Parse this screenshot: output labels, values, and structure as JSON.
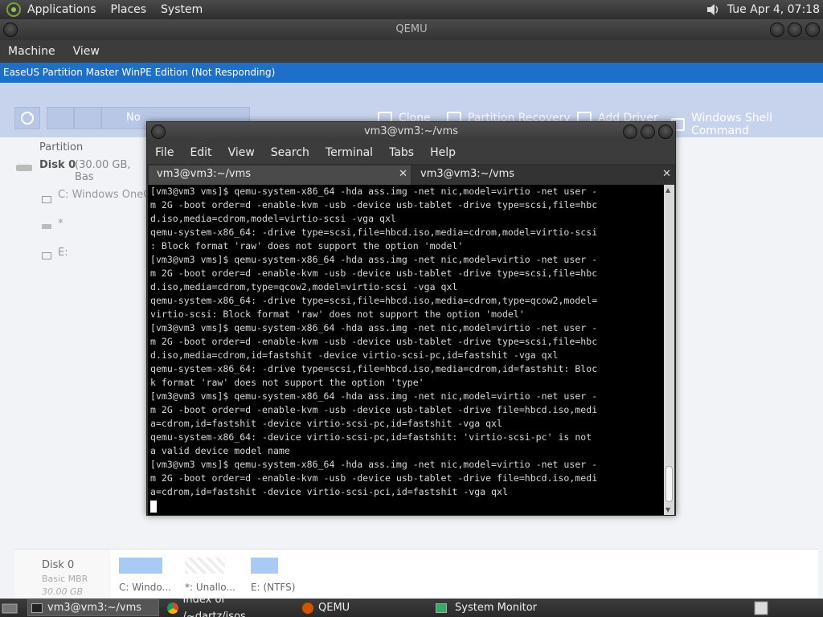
{
  "top_panel": {
    "menus": [
      "Applications",
      "Places",
      "System"
    ],
    "clock": "Tue Apr  4, 07:18"
  },
  "qemu": {
    "title": "QEMU",
    "menus": [
      "Machine",
      "View"
    ]
  },
  "easeus": {
    "title": "EaseUS Partition Master WinPE Edition (Not Responding)",
    "toolbar": {
      "undo_text": "No",
      "clone": "Clone",
      "partition_recovery": "Partition Recovery",
      "add_driver": "Add Driver",
      "windows_shell": "Windows Shell Command"
    },
    "left": {
      "header": "Partition",
      "disk": "Disk 0",
      "disk_info": "(30.00 GB, Bas",
      "partitions": [
        "C: Windows OneC",
        "*",
        "E:"
      ]
    },
    "map": {
      "disk": "Disk 0",
      "type": "Basic MBR",
      "size": "30.00 GB",
      "labels": [
        "C: Windo...",
        "*: Unallo...",
        "E: (NTFS)"
      ]
    }
  },
  "terminal": {
    "title": "vm3@vm3:~/vms",
    "menus": [
      "File",
      "Edit",
      "View",
      "Search",
      "Terminal",
      "Tabs",
      "Help"
    ],
    "tabs": [
      "vm3@vm3:~/vms",
      "vm3@vm3:~/vms"
    ],
    "lines": [
      "[vm3@vm3 vms]$ qemu-system-x86_64 -hda ass.img -net nic,model=virtio -net user -",
      "m 2G -boot order=d -enable-kvm -usb -device usb-tablet -drive type=scsi,file=hbc",
      "d.iso,media=cdrom,model=virtio-scsi -vga qxl",
      "qemu-system-x86_64: -drive type=scsi,file=hbcd.iso,media=cdrom,model=virtio-scsi",
      ": Block format 'raw' does not support the option 'model'",
      "[vm3@vm3 vms]$ qemu-system-x86_64 -hda ass.img -net nic,model=virtio -net user -",
      "m 2G -boot order=d -enable-kvm -usb -device usb-tablet -drive type=scsi,file=hbc",
      "d.iso,media=cdrom,type=qcow2,model=virtio-scsi -vga qxl",
      "qemu-system-x86_64: -drive type=scsi,file=hbcd.iso,media=cdrom,type=qcow2,model=",
      "virtio-scsi: Block format 'raw' does not support the option 'model'",
      "[vm3@vm3 vms]$ qemu-system-x86_64 -hda ass.img -net nic,model=virtio -net user -",
      "m 2G -boot order=d -enable-kvm -usb -device usb-tablet -drive type=scsi,file=hbc",
      "d.iso,media=cdrom,id=fastshit -device virtio-scsi-pc,id=fastshit -vga qxl",
      "qemu-system-x86_64: -drive type=scsi,file=hbcd.iso,media=cdrom,id=fastshit: Bloc",
      "k format 'raw' does not support the option 'type'",
      "[vm3@vm3 vms]$ qemu-system-x86_64 -hda ass.img -net nic,model=virtio -net user -",
      "m 2G -boot order=d -enable-kvm -usb -device usb-tablet -drive file=hbcd.iso,medi",
      "a=cdrom,id=fastshit -device virtio-scsi-pc,id=fastshit -vga qxl",
      "qemu-system-x86_64: -device virtio-scsi-pc,id=fastshit: 'virtio-scsi-pc' is not",
      "a valid device model name",
      "[vm3@vm3 vms]$ qemu-system-x86_64 -hda ass.img -net nic,model=virtio -net user -",
      "m 2G -boot order=d -enable-kvm -usb -device usb-tablet -drive file=hbcd.iso,medi",
      "a=cdrom,id=fastshit -device virtio-scsi-pci,id=fastshit -vga qxl"
    ]
  },
  "taskbar": {
    "tasks": [
      "vm3@vm3:~/vms",
      "Index of /~dartz/isos...",
      "QEMU",
      "System Monitor"
    ]
  }
}
